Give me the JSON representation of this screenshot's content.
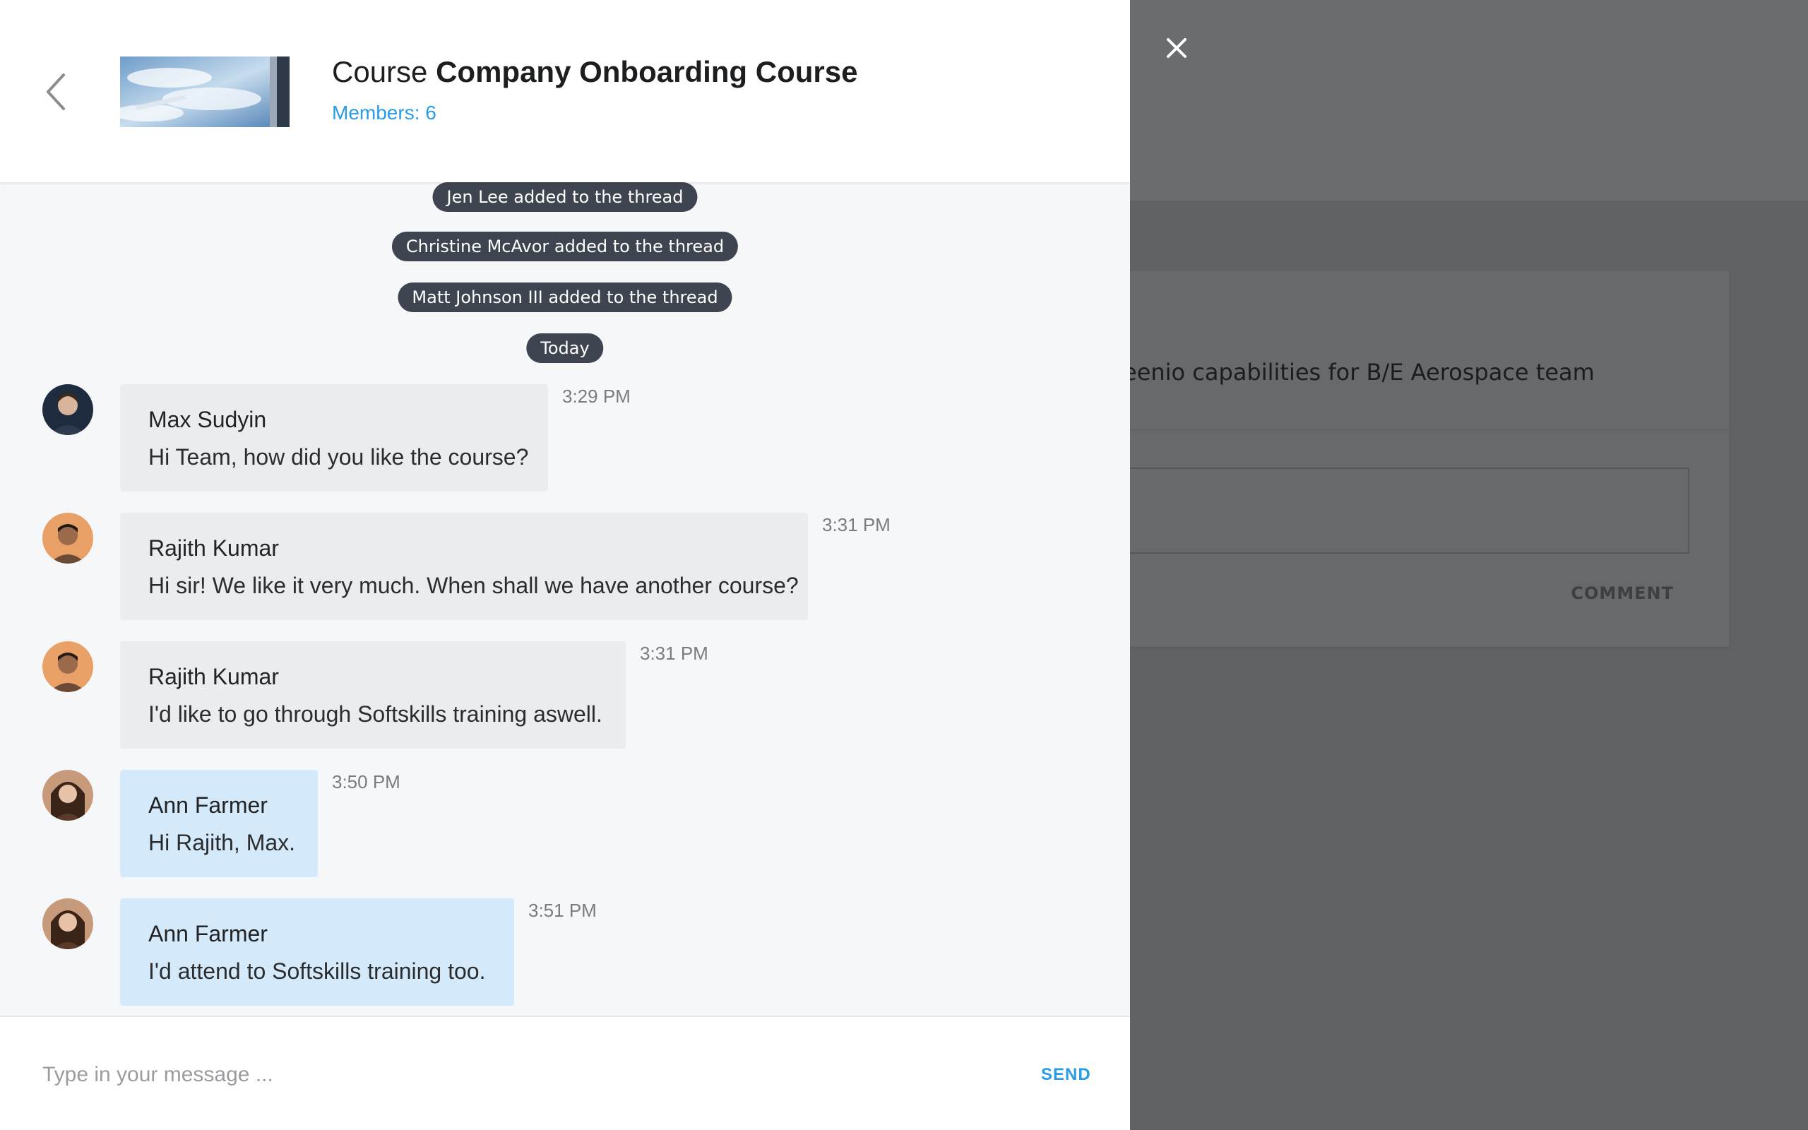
{
  "header": {
    "title_prefix": "Course",
    "title_name": "Company Onboarding Course",
    "members": "Members: 6"
  },
  "background": {
    "card_title": "eenio capabilities for B/E Aerospace team",
    "comment_label": "COMMENT"
  },
  "system_messages": [
    "Jen Lee added to the thread",
    "Christine McAvor added to the thread",
    "Matt Johnson III added to the thread",
    "Today"
  ],
  "messages": [
    {
      "name": "Max Sudyin",
      "text": "Hi Team, how did you like the course?",
      "time": "3:29 PM",
      "style": "grey"
    },
    {
      "name": "Rajith Kumar",
      "text": "Hi sir! We like it very much. When shall we have another course?",
      "time": "3:31 PM",
      "style": "grey"
    },
    {
      "name": "Rajith Kumar",
      "text": "I'd like to go through Softskills training aswell.",
      "time": "3:31 PM",
      "style": "grey"
    },
    {
      "name": "Ann Farmer",
      "text": "Hi Rajith, Max.",
      "time": "3:50 PM",
      "style": "blue"
    },
    {
      "name": "Ann Farmer",
      "text": "I'd attend to Softskills training too.",
      "time": "3:51 PM",
      "style": "blue"
    }
  ],
  "composer": {
    "placeholder": "Type in your message ...",
    "send_label": "SEND"
  },
  "colors": {
    "accent": "#2a9be8",
    "pill": "#3f4550",
    "bubble_grey": "#ebecee",
    "bubble_blue": "#d4eafb",
    "overlay": "#616265"
  },
  "icons": [
    "close-icon",
    "back-chevron-icon"
  ]
}
